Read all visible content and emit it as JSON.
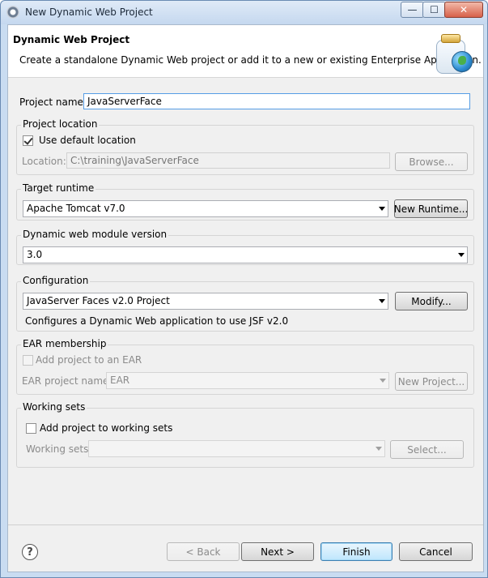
{
  "window": {
    "title": "New Dynamic Web Project",
    "controls": {
      "minimize": "—",
      "maximize": "☐",
      "close": "✕"
    }
  },
  "header": {
    "title": "Dynamic Web Project",
    "description": "Create a standalone Dynamic Web project or add it to a new or existing Enterprise Application."
  },
  "project_name": {
    "label": "Project name:",
    "value": "JavaServerFace"
  },
  "project_location": {
    "group_title": "Project location",
    "use_default_label": "Use default location",
    "use_default_checked": true,
    "location_label": "Location:",
    "location_value": "C:\\training\\JavaServerFace",
    "browse_label": "Browse..."
  },
  "target_runtime": {
    "group_title": "Target runtime",
    "selected": "Apache Tomcat v7.0",
    "new_runtime_label": "New Runtime..."
  },
  "module_version": {
    "group_title": "Dynamic web module version",
    "selected": "3.0"
  },
  "configuration": {
    "group_title": "Configuration",
    "selected": "JavaServer Faces v2.0 Project",
    "modify_label": "Modify...",
    "description": "Configures a Dynamic Web application to use JSF v2.0"
  },
  "ear": {
    "group_title": "EAR membership",
    "add_label": "Add project to an EAR",
    "project_name_label": "EAR project name:",
    "project_value": "EAR",
    "new_project_label": "New Project..."
  },
  "working_sets": {
    "group_title": "Working sets",
    "add_label": "Add project to working sets",
    "sets_label": "Working sets:",
    "sets_value": "",
    "select_label": "Select..."
  },
  "footer": {
    "help_glyph": "?",
    "back_label": "< Back",
    "next_label": "Next >",
    "finish_label": "Finish",
    "cancel_label": "Cancel"
  }
}
